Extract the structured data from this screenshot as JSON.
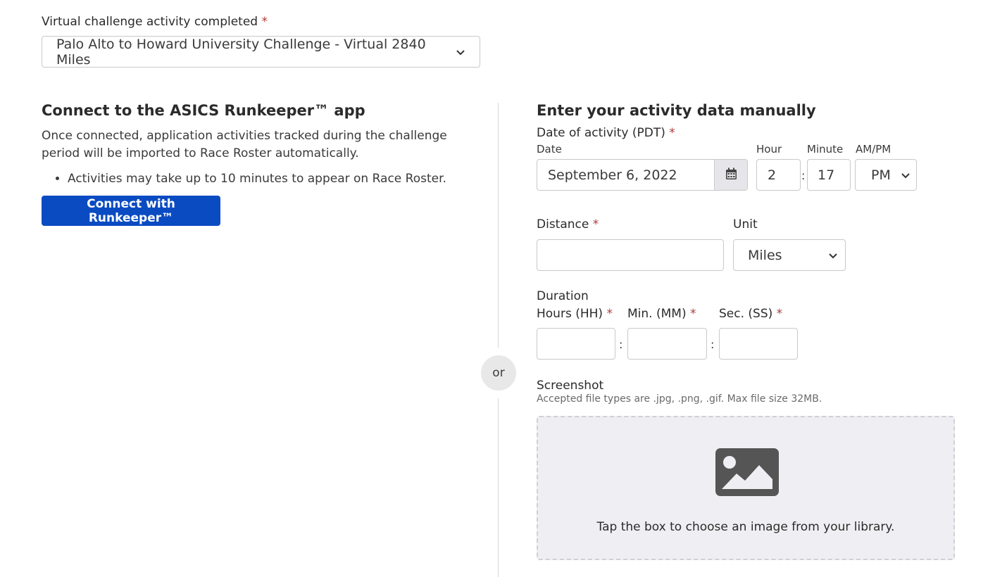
{
  "challenge": {
    "label": "Virtual challenge activity completed",
    "required_mark": "*",
    "selected": "Palo Alto to Howard University Challenge - Virtual 2840 Miles"
  },
  "connect": {
    "title": "Connect to the ASICS Runkeeper™ app",
    "description": "Once connected, application activities tracked during the challenge period will be imported to Race Roster automatically.",
    "bullets": [
      "Activities may take up to 10 minutes to appear on Race Roster."
    ],
    "button_label": "Connect with Runkeeper™"
  },
  "divider": {
    "label": "or"
  },
  "manual": {
    "title": "Enter your activity data manually",
    "date_label": "Date of activity (PDT)",
    "required_mark": "*",
    "date_sub": "Date",
    "date_value": "September 6, 2022",
    "hour_label": "Hour",
    "hour_value": "2",
    "minute_label": "Minute",
    "minute_value": "17",
    "ampm_label": "AM/PM",
    "ampm_value": "PM",
    "time_separator": ":",
    "distance_label": "Distance",
    "distance_value": "",
    "unit_label": "Unit",
    "unit_value": "Miles",
    "duration_label": "Duration",
    "hours_label": "Hours (HH)",
    "hours_value": "",
    "minutes_label": "Min. (MM)",
    "minutes_value": "",
    "seconds_label": "Sec. (SS)",
    "seconds_value": "",
    "duration_separator": ":",
    "screenshot_label": "Screenshot",
    "screenshot_hint": "Accepted file types are .jpg, .png, .gif. Max file size 32MB.",
    "upload_text": "Tap the box to choose an image from your library."
  },
  "icons": {
    "select_arrow": "chevron-down-icon",
    "calendar": "calendar-icon",
    "upload": "image-icon"
  },
  "colors": {
    "accent": "#0a4bc2",
    "required": "#b03a3a",
    "upload_bg": "#efeff3",
    "upload_icon": "#555555"
  }
}
